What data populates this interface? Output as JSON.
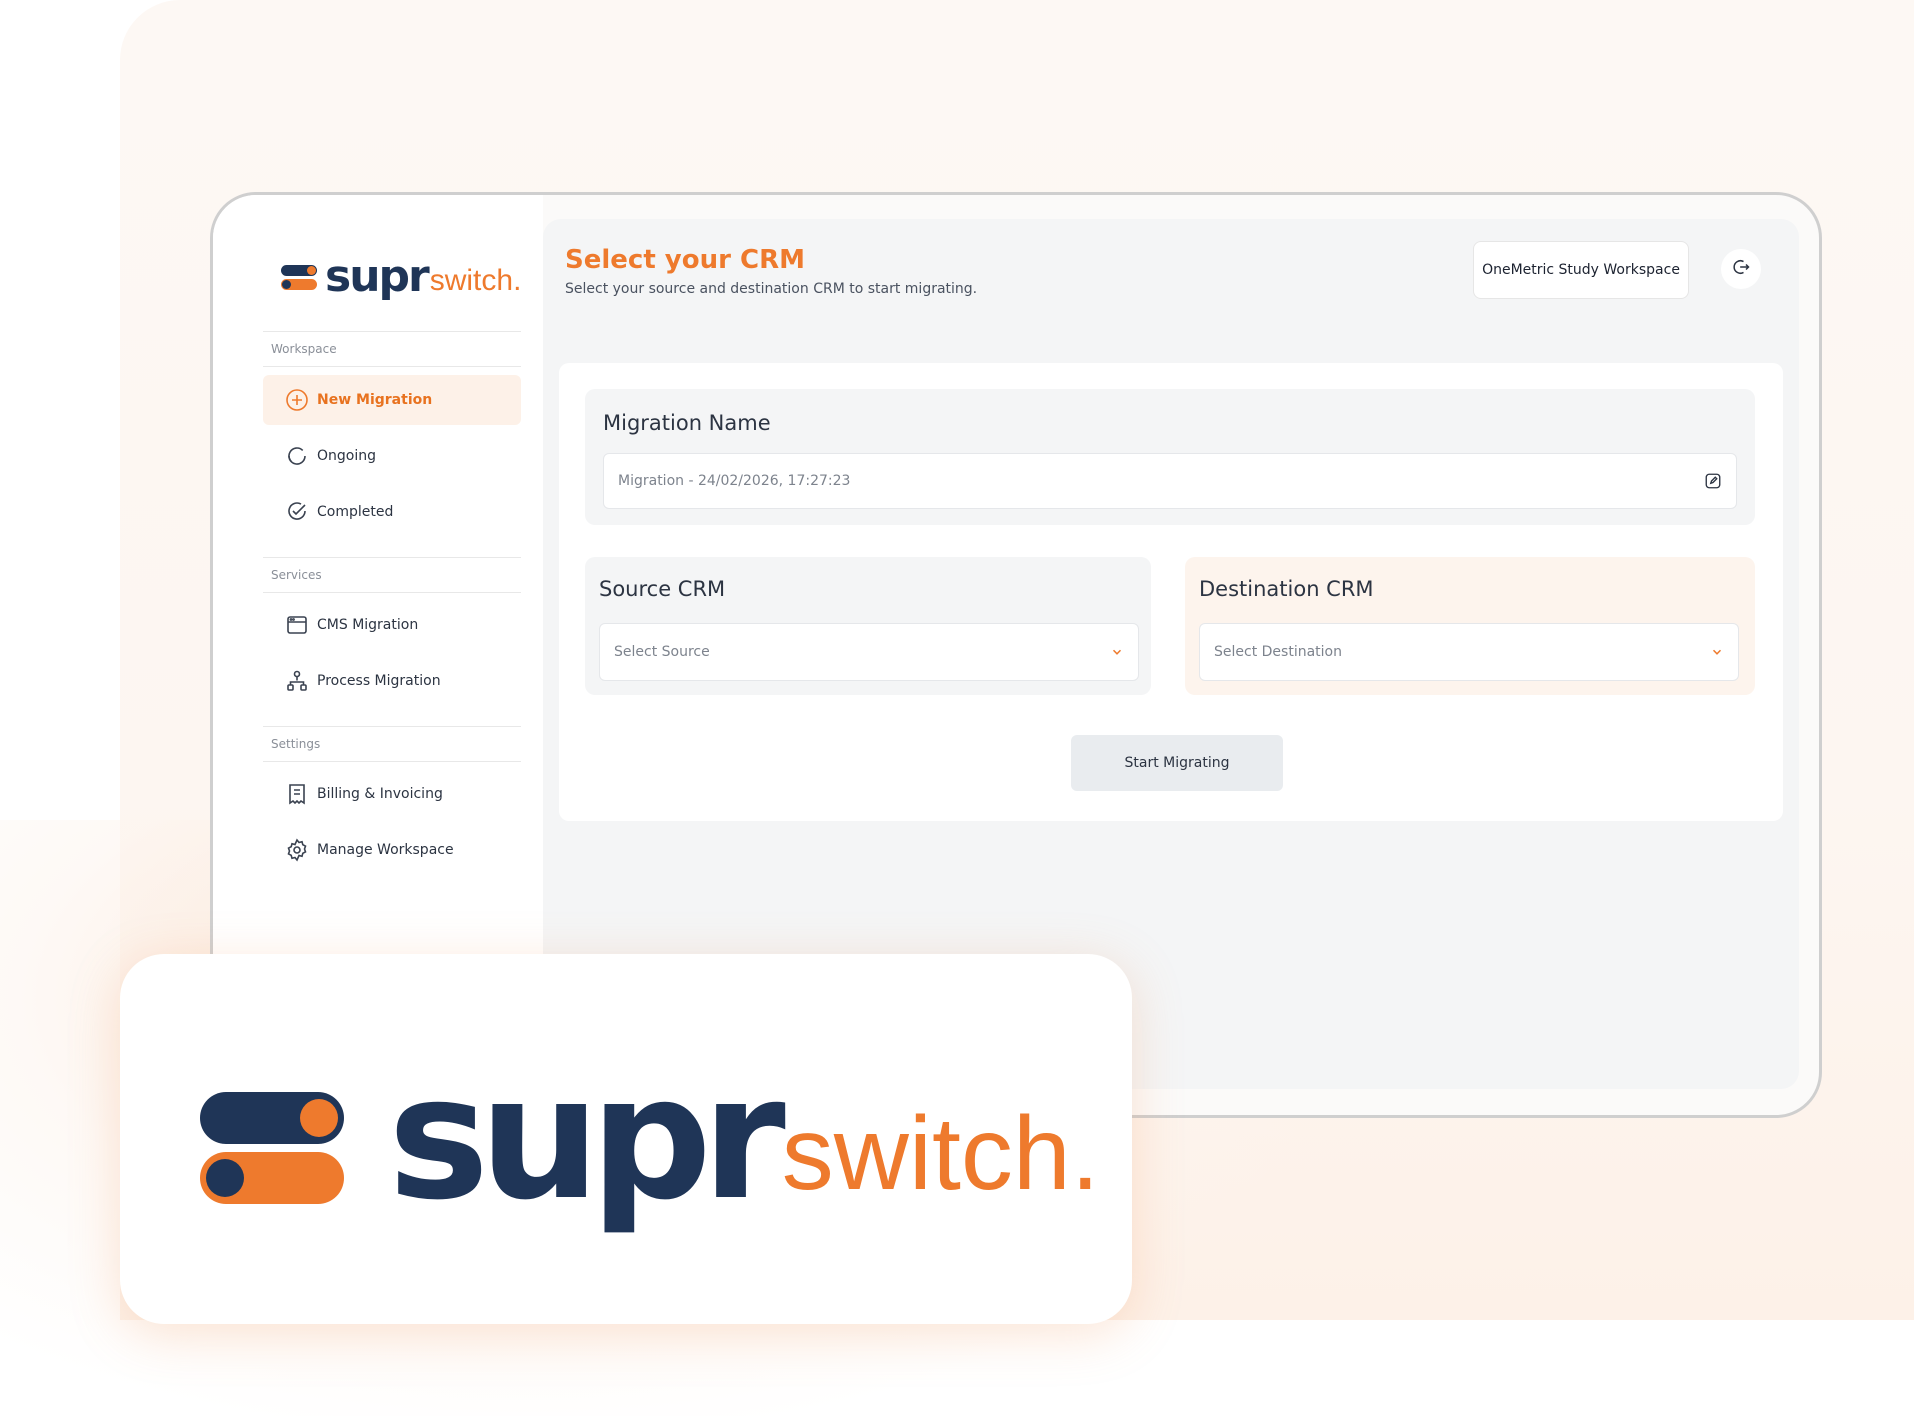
{
  "brand": {
    "supr": "supr",
    "switch": "switch.",
    "accent": "#ee7a2d",
    "navy": "#1f3557"
  },
  "sidebar": {
    "sections": [
      "Workspace",
      "Services",
      "Settings"
    ],
    "items": [
      {
        "label": "New Migration",
        "icon": "plus-circle-icon",
        "active": true
      },
      {
        "label": "Ongoing",
        "icon": "refresh-icon"
      },
      {
        "label": "Completed",
        "icon": "check-circle-icon"
      },
      {
        "label": "CMS Migration",
        "icon": "browser-window-icon"
      },
      {
        "label": "Process Migration",
        "icon": "flow-chart-icon"
      },
      {
        "label": "Billing & Invoicing",
        "icon": "receipt-icon"
      },
      {
        "label": "Manage Workspace",
        "icon": "gear-icon"
      }
    ]
  },
  "header": {
    "title": "Select your CRM",
    "subtitle": "Select your source and destination CRM to start migrating.",
    "workspace": "OneMetric Study Workspace",
    "logout_icon": "logout-icon"
  },
  "form": {
    "migration_name_label": "Migration Name",
    "migration_name_placeholder": "Migration - 24/02/2026, 17:27:23",
    "source_label": "Source CRM",
    "source_placeholder": "Select Source",
    "destination_label": "Destination CRM",
    "destination_placeholder": "Select Destination",
    "start_button": "Start Migrating"
  }
}
